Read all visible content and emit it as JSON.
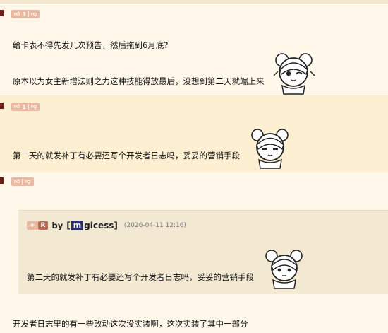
{
  "posts": [
    {
      "votes": "3",
      "lines": [
        "给卡表不得先发几次预告，然后拖到6月底?",
        "原本以为女主新增法则之力这种技能得放最后，没想到第二天就端上来"
      ]
    },
    {
      "votes": "1",
      "lines": [
        "第二天的就发补丁有必要还写个开发者日志吗，妥妥的营销手段"
      ]
    },
    {
      "votes": "",
      "quote": {
        "plus": "+",
        "r": "R",
        "by": "by",
        "user_open": "[",
        "user_m": "m",
        "user_rest": "gicess",
        "user_close": "]",
        "date": "(2026-04-11 12:16)",
        "text": "第二天的就发补丁有必要还写个开发者日志吗，妥妥的营销手段"
      },
      "lines": [
        "开发者日志里的有一些改动这次没实装啊，这次实装了其中一部分"
      ]
    }
  ],
  "icons": {
    "thumb_up": "thumb-up-icon",
    "thumb_down": "thumb-down-icon",
    "avatar": "anime-girl-avatar"
  },
  "colors": {
    "page_bg": "#fff8ea",
    "alt_bg": "#fcefd2",
    "vote_bar": "#e8b8a0",
    "floor_marker": "#6b1f16",
    "quote_bg": "#f3e9d3"
  }
}
